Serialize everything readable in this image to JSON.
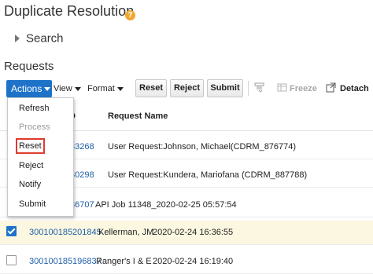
{
  "page": {
    "title": "Duplicate Resolution",
    "help_icon_glyph": "?"
  },
  "search": {
    "label": "Search",
    "expanded": false
  },
  "section": {
    "title": "Requests"
  },
  "toolbar": {
    "actions_label": "Actions",
    "view_label": "View",
    "format_label": "Format",
    "reset_label": "Reset",
    "reject_label": "Reject",
    "submit_label": "Submit",
    "freeze_label": "Freeze",
    "detach_label": "Detach"
  },
  "table": {
    "columns": {
      "id_fragment": "D",
      "name": "Request Name"
    },
    "rows": [
      {
        "id": "33268",
        "name": "User Request:Johnson, Michael(CDRM_876774)",
        "date": "",
        "checked": false
      },
      {
        "id": "30298",
        "name": "User Request:Kundera, Mariofana  (CDRM_887788)",
        "date": "",
        "checked": false
      },
      {
        "id": "86707",
        "name": "API Job 11348_2020-02-25 05:57:54",
        "date": "",
        "checked": false
      },
      {
        "id": "300100185201845",
        "name": "Kellerman, JM",
        "date": "2020-02-24 16:36:55",
        "checked": true
      },
      {
        "id": "300100185196837",
        "name": "Ranger's I & E",
        "date": "2020-02-24 16:19:40",
        "checked": false
      }
    ]
  },
  "actions_menu": {
    "items": [
      {
        "label": "Refresh",
        "enabled": true,
        "highlighted": false
      },
      {
        "label": "Process",
        "enabled": false,
        "highlighted": false
      },
      {
        "label": "Reset",
        "enabled": true,
        "highlighted": true
      },
      {
        "label": "Reject",
        "enabled": true,
        "highlighted": false
      },
      {
        "label": "Notify",
        "enabled": true,
        "highlighted": false
      },
      {
        "label": "Submit",
        "enabled": true,
        "highlighted": false
      }
    ]
  },
  "colors": {
    "accent": "#1e73c9",
    "link": "#1e5fa8",
    "selected_row": "#fbf7e0",
    "callout": "#e03a2c",
    "help_icon": "#f0a830"
  }
}
